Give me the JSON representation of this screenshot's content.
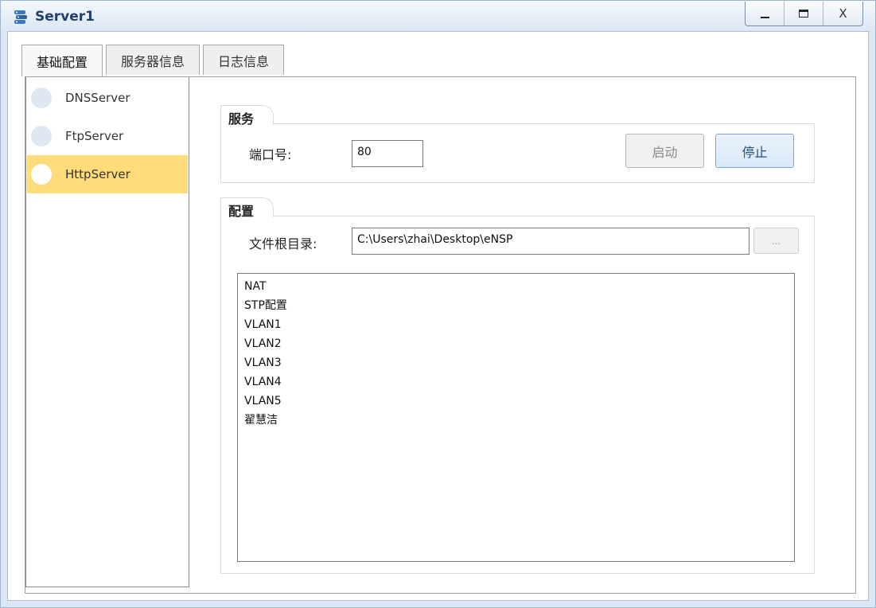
{
  "window": {
    "title": "Server1"
  },
  "title_buttons": {
    "minimize_icon": "minimize-icon",
    "maximize_icon": "maximize-icon",
    "close": "X"
  },
  "tabs": [
    {
      "label": "基础配置",
      "active": true
    },
    {
      "label": "服务器信息",
      "active": false
    },
    {
      "label": "日志信息",
      "active": false
    }
  ],
  "servers": [
    {
      "label": "DNSServer",
      "selected": false
    },
    {
      "label": "FtpServer",
      "selected": false
    },
    {
      "label": "HttpServer",
      "selected": true
    }
  ],
  "service": {
    "title": "服务",
    "port_label": "端口号:",
    "port_value": "80",
    "start_label": "启动",
    "stop_label": "停止"
  },
  "config": {
    "title": "配置",
    "root_label": "文件根目录:",
    "root_value": "C:\\Users\\zhai\\Desktop\\eNSP",
    "browse_label": "...",
    "files": [
      "NAT",
      "STP配置",
      "VLAN1",
      "VLAN2",
      "VLAN3",
      "VLAN4",
      "VLAN5",
      "翟慧洁"
    ]
  },
  "colors": {
    "selected_bg": "#ffdc7a",
    "title_text": "#1f3f6e",
    "accent": "#234f86"
  }
}
